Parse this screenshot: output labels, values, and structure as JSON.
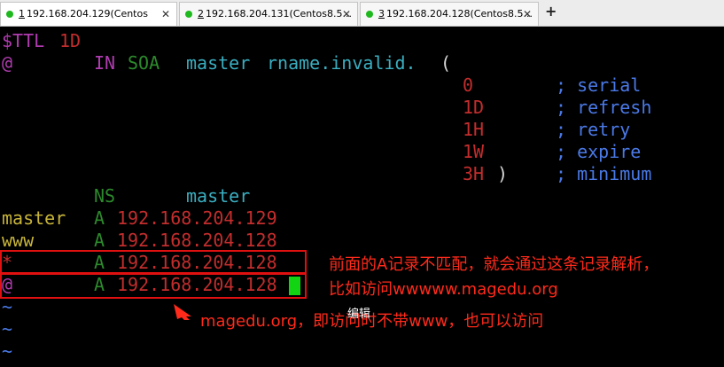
{
  "tabs": [
    {
      "number": "1",
      "title": "192.168.204.129(Centos",
      "close": "✕"
    },
    {
      "number": "2",
      "title": "192.168.204.131(Centos8.5...",
      "close": "✕"
    },
    {
      "number": "3",
      "title": "192.168.204.128(Centos8.5...",
      "close": "✕"
    }
  ],
  "new_tab": "+",
  "terminal": {
    "line1": {
      "directive": "$TTL",
      "value": "1D"
    },
    "line2": {
      "owner": "@",
      "class": "IN",
      "type": "SOA",
      "mname": "master",
      "rname": "rname.invalid.",
      "paren": "("
    },
    "soa_values": [
      {
        "value": "0",
        "comment": "; serial"
      },
      {
        "value": "1D",
        "comment": "; refresh"
      },
      {
        "value": "1H",
        "comment": "; retry"
      },
      {
        "value": "1W",
        "comment": "; expire"
      },
      {
        "value": "3H",
        "close": ")",
        "comment": "; minimum"
      }
    ],
    "ns_record": {
      "type": "NS",
      "target": "master"
    },
    "a_records": [
      {
        "owner": "master",
        "type": "A",
        "ip": "192.168.204.129"
      },
      {
        "owner": "www",
        "type": "A",
        "ip": "192.168.204.128"
      },
      {
        "owner": "*",
        "type": "A",
        "ip": "192.168.204.128"
      },
      {
        "owner": "@",
        "type": "A",
        "ip": "192.168.204.128"
      }
    ],
    "tildes": [
      "~",
      "~",
      "~"
    ]
  },
  "annotations": {
    "note1_line1": "前面的A记录不匹配，就会通过这条记录解析，",
    "note1_line2": "比如访问wwwww.magedu.org",
    "note2": "magedu.org，即访问时不带www，也可以访问"
  },
  "popup_text": "编辑",
  "colors": {
    "accent_red": "#e01010",
    "cursor_green": "#12d412",
    "tab_dot_green": "#1fb81f"
  }
}
